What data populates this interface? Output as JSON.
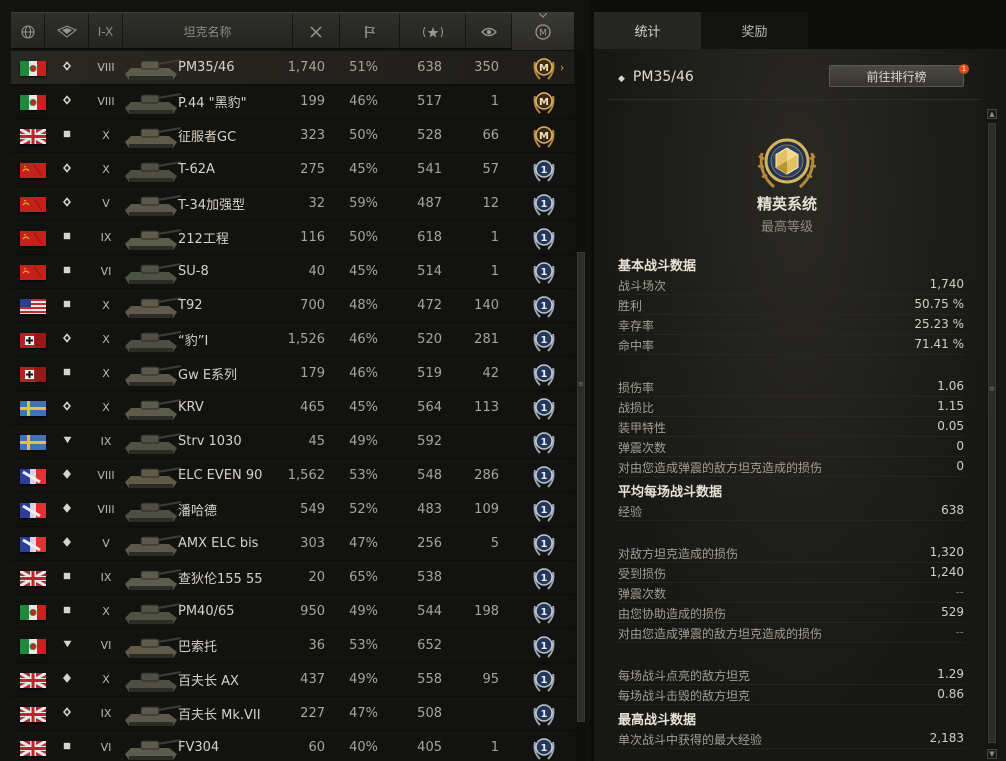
{
  "header": {
    "col_name": "坦克名称",
    "col_tier": "I-X"
  },
  "rows": [
    {
      "flag": "italy",
      "cls": "medium",
      "tier": "VIII",
      "name": "PM35/46",
      "battles": "1,740",
      "winrate": "51%",
      "exp": "638",
      "dmg": "350",
      "medal": "M",
      "selected": true
    },
    {
      "flag": "italy",
      "cls": "medium",
      "tier": "VIII",
      "name": "P.44 \"黑豹\"",
      "battles": "199",
      "winrate": "46%",
      "exp": "517",
      "dmg": "1",
      "medal": "M"
    },
    {
      "flag": "uk",
      "cls": "heavy",
      "tier": "X",
      "name": "征服者GC",
      "battles": "323",
      "winrate": "50%",
      "exp": "528",
      "dmg": "66",
      "medal": "M"
    },
    {
      "flag": "ussr",
      "cls": "medium",
      "tier": "X",
      "name": "T-62A",
      "battles": "275",
      "winrate": "45%",
      "exp": "541",
      "dmg": "57",
      "medal": "1"
    },
    {
      "flag": "ussr",
      "cls": "medium",
      "tier": "V",
      "name": "T-34加强型",
      "battles": "32",
      "winrate": "59%",
      "exp": "487",
      "dmg": "12",
      "medal": "1"
    },
    {
      "flag": "ussr",
      "cls": "heavy",
      "tier": "IX",
      "name": "212工程",
      "battles": "116",
      "winrate": "50%",
      "exp": "618",
      "dmg": "1",
      "medal": "1"
    },
    {
      "flag": "ussr",
      "cls": "heavy",
      "tier": "VI",
      "name": "SU-8",
      "battles": "40",
      "winrate": "45%",
      "exp": "514",
      "dmg": "1",
      "medal": "1"
    },
    {
      "flag": "usa",
      "cls": "heavy",
      "tier": "X",
      "name": "T92",
      "battles": "700",
      "winrate": "48%",
      "exp": "472",
      "dmg": "140",
      "medal": "1"
    },
    {
      "flag": "germany",
      "cls": "medium",
      "tier": "X",
      "name": "“豹”I",
      "battles": "1,526",
      "winrate": "46%",
      "exp": "520",
      "dmg": "281",
      "medal": "1"
    },
    {
      "flag": "germany",
      "cls": "heavy",
      "tier": "X",
      "name": "Gw E系列",
      "battles": "179",
      "winrate": "46%",
      "exp": "519",
      "dmg": "42",
      "medal": "1"
    },
    {
      "flag": "sweden",
      "cls": "medium",
      "tier": "X",
      "name": "KRV",
      "battles": "465",
      "winrate": "45%",
      "exp": "564",
      "dmg": "113",
      "medal": "1"
    },
    {
      "flag": "sweden",
      "cls": "td",
      "tier": "IX",
      "name": "Strv 1030",
      "battles": "45",
      "winrate": "49%",
      "exp": "592",
      "dmg": "",
      "medal": "1"
    },
    {
      "flag": "france",
      "cls": "light",
      "tier": "VIII",
      "name": "ELC EVEN 90",
      "battles": "1,562",
      "winrate": "53%",
      "exp": "548",
      "dmg": "286",
      "medal": "1"
    },
    {
      "flag": "france",
      "cls": "light",
      "tier": "VIII",
      "name": "潘哈德",
      "battles": "549",
      "winrate": "52%",
      "exp": "483",
      "dmg": "109",
      "medal": "1"
    },
    {
      "flag": "france",
      "cls": "light",
      "tier": "V",
      "name": "AMX ELC bis",
      "battles": "303",
      "winrate": "47%",
      "exp": "256",
      "dmg": "5",
      "medal": "1"
    },
    {
      "flag": "uk",
      "cls": "heavy",
      "tier": "IX",
      "name": "查狄伦155 55",
      "battles": "20",
      "winrate": "65%",
      "exp": "538",
      "dmg": "",
      "medal": "1"
    },
    {
      "flag": "italy",
      "cls": "heavy",
      "tier": "X",
      "name": "PM40/65",
      "battles": "950",
      "winrate": "49%",
      "exp": "544",
      "dmg": "198",
      "medal": "1"
    },
    {
      "flag": "italy",
      "cls": "td",
      "tier": "VI",
      "name": "巴索托",
      "battles": "36",
      "winrate": "53%",
      "exp": "652",
      "dmg": "",
      "medal": "1"
    },
    {
      "flag": "uk",
      "cls": "light",
      "tier": "X",
      "name": "百夫长 AX",
      "battles": "437",
      "winrate": "49%",
      "exp": "558",
      "dmg": "95",
      "medal": "1"
    },
    {
      "flag": "uk",
      "cls": "medium",
      "tier": "IX",
      "name": "百夫长 Mk.VII",
      "battles": "227",
      "winrate": "47%",
      "exp": "508",
      "dmg": "",
      "medal": "1"
    },
    {
      "flag": "uk",
      "cls": "heavy",
      "tier": "VI",
      "name": "FV304",
      "battles": "60",
      "winrate": "40%",
      "exp": "405",
      "dmg": "1",
      "medal": "1"
    }
  ],
  "tabs": [
    {
      "label": "统计"
    },
    {
      "label": "奖励"
    }
  ],
  "detail": {
    "tank_name": "PM35/46",
    "rank_button": "前往排行榜",
    "notif": "1",
    "elite_title": "精英系统",
    "elite_sub": "最高等级",
    "sections": [
      {
        "title": "基本战斗数据",
        "items": [
          {
            "label": "战斗场次",
            "value": "1,740"
          },
          {
            "label": "胜利",
            "value": "50.75 %"
          },
          {
            "label": "幸存率",
            "value": "25.23 %"
          },
          {
            "label": "命中率",
            "value": "71.41 %"
          }
        ]
      },
      {
        "title": "",
        "items": [
          {
            "label": "损伤率",
            "value": "1.06"
          },
          {
            "label": "战损比",
            "value": "1.15"
          },
          {
            "label": "装甲特性",
            "value": "0.05"
          },
          {
            "label": "弹震次数",
            "value": "0"
          },
          {
            "label": "对由您造成弹震的敌方坦克造成的损伤",
            "value": "0"
          }
        ]
      },
      {
        "title": "平均每场战斗数据",
        "items": [
          {
            "label": "经验",
            "value": "638"
          }
        ]
      },
      {
        "title": "",
        "items": [
          {
            "label": "对敌方坦克造成的损伤",
            "value": "1,320"
          },
          {
            "label": "受到损伤",
            "value": "1,240"
          },
          {
            "label": "弹震次数",
            "value": "--"
          },
          {
            "label": "由您协助造成的损伤",
            "value": "529"
          },
          {
            "label": "对由您造成弹震的敌方坦克造成的损伤",
            "value": "--"
          }
        ]
      },
      {
        "title": "",
        "items": [
          {
            "label": "每场战斗点亮的敌方坦克",
            "value": "1.29"
          },
          {
            "label": "每场战斗击毁的敌方坦克",
            "value": "0.86"
          }
        ]
      },
      {
        "title": "最高战斗数据",
        "items": [
          {
            "label": "单次战斗中获得的最大经验",
            "value": "2,183"
          }
        ]
      }
    ]
  }
}
